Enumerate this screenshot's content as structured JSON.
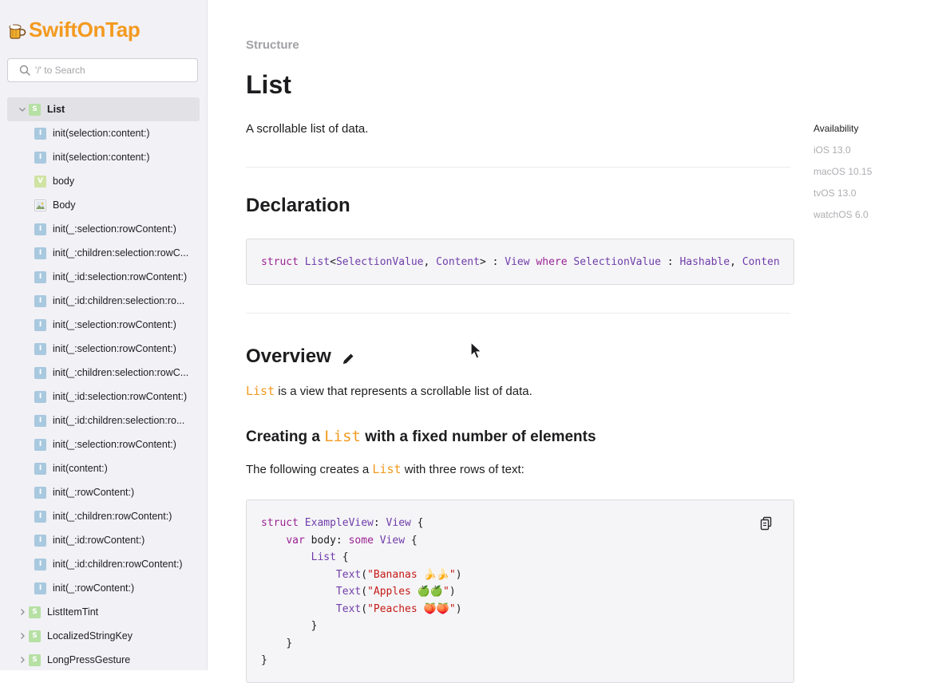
{
  "brand": {
    "name_part1": "Swift",
    "name_part2": "OnTap"
  },
  "search": {
    "placeholder": "'/' to Search"
  },
  "sidebar": {
    "items": [
      {
        "label": "List",
        "badge": "S",
        "level": "top",
        "expanded": true,
        "active": true
      },
      {
        "label": "init(selection:content:)",
        "badge": "I",
        "level": "child"
      },
      {
        "label": "init(selection:content:)",
        "badge": "I",
        "level": "child"
      },
      {
        "label": "body",
        "badge": "V",
        "level": "child"
      },
      {
        "label": "Body",
        "badge": "img",
        "level": "child"
      },
      {
        "label": "init(_:selection:rowContent:)",
        "badge": "I",
        "level": "child"
      },
      {
        "label": "init(_:children:selection:rowC...",
        "badge": "I",
        "level": "child"
      },
      {
        "label": "init(_:id:selection:rowContent:)",
        "badge": "I",
        "level": "child"
      },
      {
        "label": "init(_:id:children:selection:ro...",
        "badge": "I",
        "level": "child"
      },
      {
        "label": "init(_:selection:rowContent:)",
        "badge": "I",
        "level": "child"
      },
      {
        "label": "init(_:selection:rowContent:)",
        "badge": "I",
        "level": "child"
      },
      {
        "label": "init(_:children:selection:rowC...",
        "badge": "I",
        "level": "child"
      },
      {
        "label": "init(_:id:selection:rowContent:)",
        "badge": "I",
        "level": "child"
      },
      {
        "label": "init(_:id:children:selection:ro...",
        "badge": "I",
        "level": "child"
      },
      {
        "label": "init(_:selection:rowContent:)",
        "badge": "I",
        "level": "child"
      },
      {
        "label": "init(content:)",
        "badge": "I",
        "level": "child"
      },
      {
        "label": "init(_:rowContent:)",
        "badge": "I",
        "level": "child"
      },
      {
        "label": "init(_:children:rowContent:)",
        "badge": "I",
        "level": "child"
      },
      {
        "label": "init(_:id:rowContent:)",
        "badge": "I",
        "level": "child"
      },
      {
        "label": "init(_:id:children:rowContent:)",
        "badge": "I",
        "level": "child"
      },
      {
        "label": "init(_:rowContent:)",
        "badge": "I",
        "level": "child"
      },
      {
        "label": "ListItemTint",
        "badge": "S",
        "level": "top",
        "expanded": false
      },
      {
        "label": "LocalizedStringKey",
        "badge": "S",
        "level": "top",
        "expanded": false
      },
      {
        "label": "LongPressGesture",
        "badge": "S",
        "level": "top",
        "expanded": false
      }
    ]
  },
  "main": {
    "eyebrow": "Structure",
    "title": "List",
    "abstract": "A scrollable list of data.",
    "declaration_heading": "Declaration",
    "declaration": {
      "kw_struct": "struct",
      "name": "List",
      "generic_open": "<",
      "param1": "SelectionValue",
      "comma": ", ",
      "param2": "Content",
      "generic_close": "> : ",
      "view": "View",
      "where": " where ",
      "param1b": "SelectionValue",
      "colon": " : ",
      "hashable": "Hashable",
      "comma2": ", ",
      "param2b": "Conten"
    },
    "overview_heading": "Overview",
    "overview_kw": "List",
    "overview_text": " is a view that represents a scrollable list of data.",
    "section_heading_pre": "Creating a ",
    "section_heading_kw": "List",
    "section_heading_post": " with a fixed number of elements",
    "section_para_pre": "The following creates a ",
    "section_para_kw": "List",
    "section_para_post": " with three rows of text:",
    "code": {
      "l1_kw": "struct",
      "l1_name": " ExampleView",
      "l1_colon": ": ",
      "l1_type": "View",
      "l1_brace": " {",
      "l2_kw": "var",
      "l2_name": " body: ",
      "l2_kw2": "some",
      "l2_type": " View",
      "l2_brace": " {",
      "l3_type": "List",
      "l3_brace": " {",
      "row1_fn": "Text",
      "row1_str": "\"Bananas 🍌🍌\"",
      "row2_fn": "Text",
      "row2_str": "\"Apples 🍏🍏\"",
      "row3_fn": "Text",
      "row3_str": "\"Peaches 🍑🍑\"",
      "close1": "}",
      "close2": "}",
      "close3": "}"
    }
  },
  "availability": {
    "title": "Availability",
    "items": [
      "iOS 13.0",
      "macOS 10.15",
      "tvOS 13.0",
      "watchOS 6.0"
    ]
  },
  "colors": {
    "brand_orange": "#f39a1f",
    "keyword_purple": "#9b2393",
    "type_purple": "#703daa",
    "string_red": "#c41a16",
    "sidebar_bg": "#f2f1f6"
  }
}
